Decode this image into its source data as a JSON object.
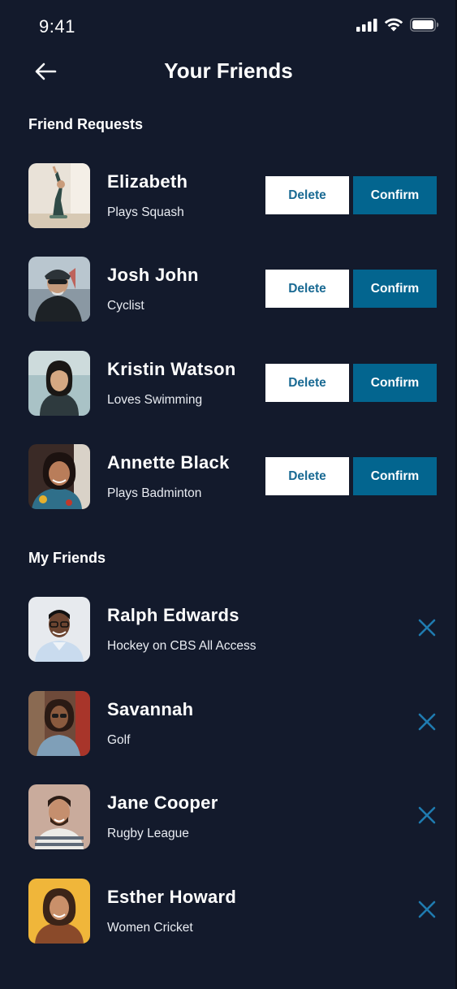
{
  "status_bar": {
    "time": "9:41"
  },
  "header": {
    "title": "Your Friends"
  },
  "requests": {
    "title": "Friend Requests",
    "delete_label": "Delete",
    "confirm_label": "Confirm",
    "items": [
      {
        "name": "Elizabeth",
        "subtitle": "Plays Squash"
      },
      {
        "name": "Josh John",
        "subtitle": "Cyclist"
      },
      {
        "name": "Kristin Watson",
        "subtitle": "Loves Swimming"
      },
      {
        "name": "Annette Black",
        "subtitle": "Plays Badminton"
      }
    ]
  },
  "friends": {
    "title": "My Friends",
    "items": [
      {
        "name": "Ralph Edwards",
        "subtitle": "Hockey on CBS All Access"
      },
      {
        "name": "Savannah",
        "subtitle": "Golf"
      },
      {
        "name": "Jane Cooper",
        "subtitle": "Rugby League"
      },
      {
        "name": "Esther Howard",
        "subtitle": "Women Cricket"
      }
    ]
  },
  "colors": {
    "background": "#131a2c",
    "accent": "#03658f",
    "delete_text": "#1a6a93",
    "remove_icon": "#1f7bb0"
  },
  "icons": {
    "back": "arrow-left-icon",
    "remove": "close-icon",
    "signal": "cellular-signal-icon",
    "wifi": "wifi-icon",
    "battery": "battery-icon"
  }
}
